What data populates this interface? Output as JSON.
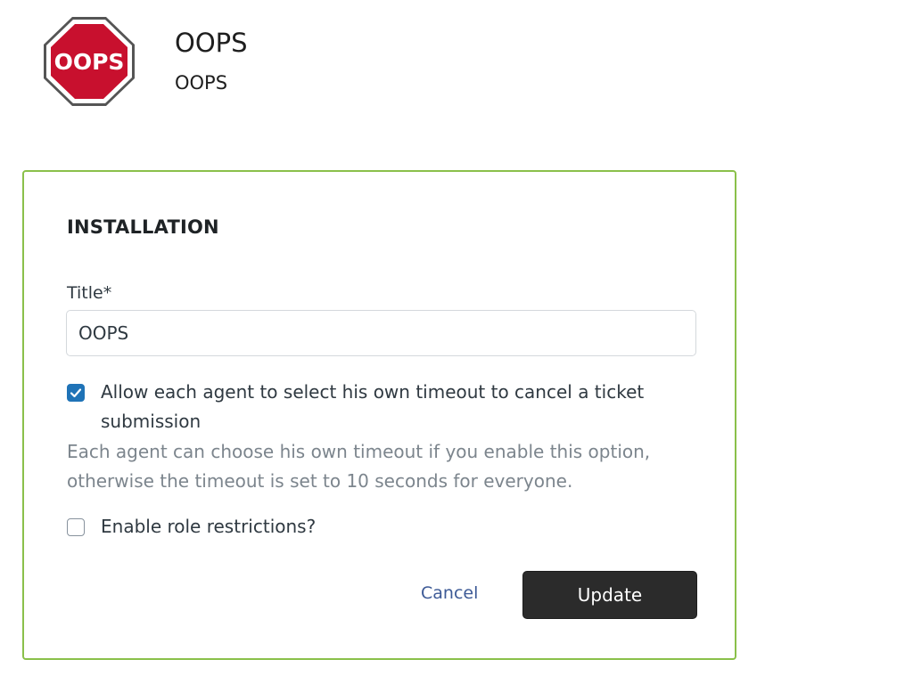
{
  "app": {
    "logo_text": "OOPS",
    "logo_color": "#c8102e",
    "title": "OOPS",
    "subtitle": "OOPS"
  },
  "installation": {
    "heading": "INSTALLATION",
    "title_field": {
      "label": "Title*",
      "value": "OOPS"
    },
    "timeout_option": {
      "checked": true,
      "label": "Allow each agent to select his own timeout to cancel a ticket submission",
      "hint": "Each agent can choose his own timeout if you enable this option, otherwise the timeout is set to 10 seconds for everyone."
    },
    "role_option": {
      "checked": false,
      "label": "Enable role restrictions?"
    },
    "actions": {
      "cancel_label": "Cancel",
      "update_label": "Update"
    }
  },
  "colors": {
    "card_border": "#8ac04a",
    "checkbox_checked": "#1f73b7",
    "primary_button": "#2b2b2b",
    "link": "#3d5a96"
  },
  "icons": {
    "app_logo": "stop-sign-logo",
    "checkbox_check": "checkmark-icon"
  }
}
